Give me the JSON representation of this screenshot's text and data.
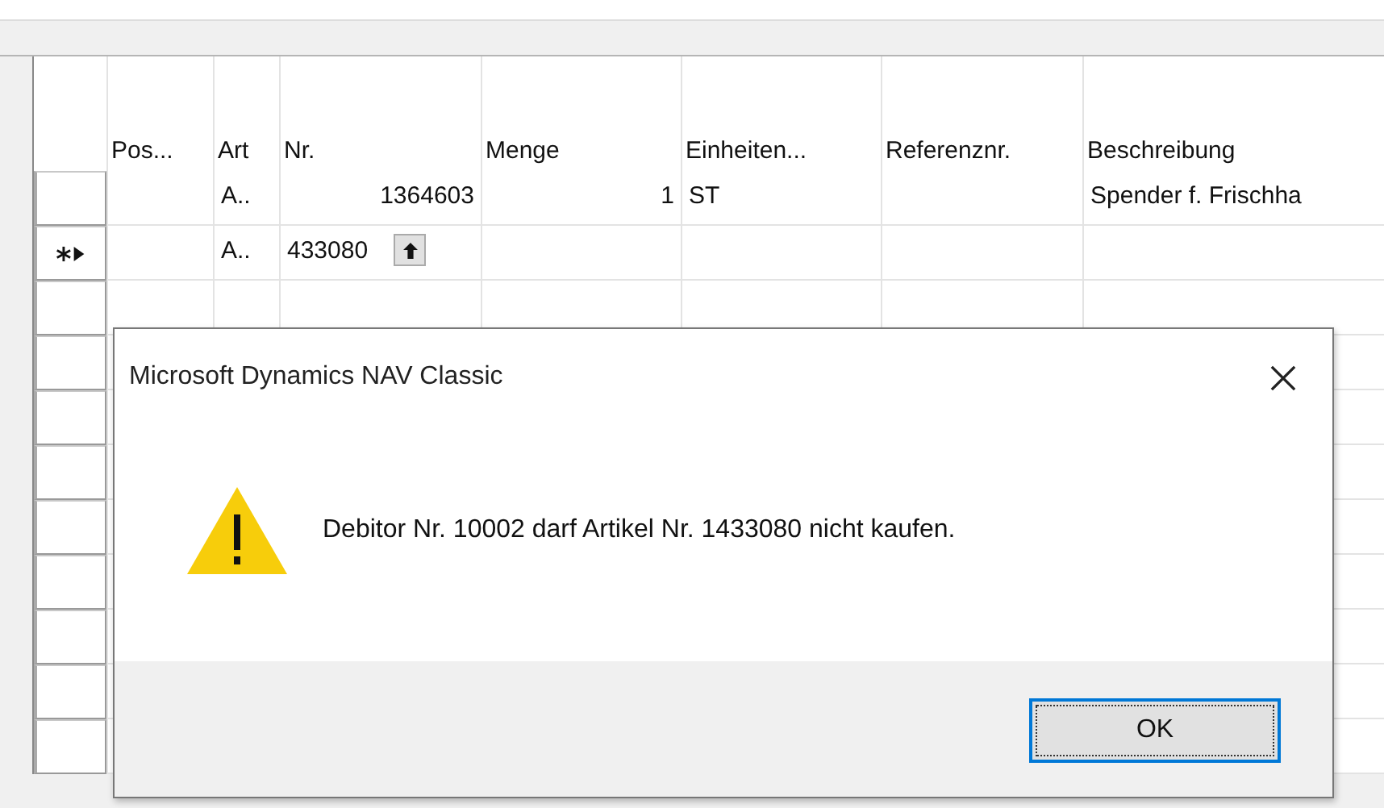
{
  "table": {
    "columns": [
      {
        "label": "Pos..."
      },
      {
        "label": "Art"
      },
      {
        "label": "Nr."
      },
      {
        "label": "Menge"
      },
      {
        "label": "Einheiten..."
      },
      {
        "label": "Referenznr."
      },
      {
        "label": "Beschreibung"
      }
    ],
    "rows": [
      {
        "current": false,
        "editing": false,
        "art": "A..",
        "nr": "1364603",
        "menge": "1",
        "einheiten": "ST",
        "beschreibung": "Spender f. Frischha"
      },
      {
        "current": true,
        "editing": true,
        "art": "A..",
        "nr": "433080"
      }
    ]
  },
  "dialog": {
    "title": "Microsoft Dynamics NAV Classic",
    "message": "Debitor Nr. 10002 darf Artikel Nr. 1433080 nicht kaufen.",
    "buttons": [
      {
        "label": "OK",
        "focused": true
      }
    ]
  }
}
